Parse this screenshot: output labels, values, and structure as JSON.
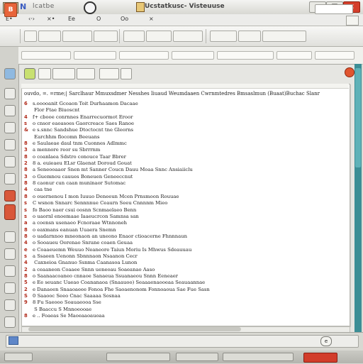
{
  "window": {
    "title": "lcatbe",
    "center_title": "Ucstatkusc- Visteuuse",
    "minimize_glyph": "–",
    "maximize_glyph": "□",
    "close_glyph": "×"
  },
  "menubar": {
    "items": [
      "E•",
      "‹·›",
      "×•",
      "Ee",
      "O",
      "Oo",
      "×"
    ]
  },
  "toolbar": {
    "app_letter": "B",
    "search_placeholder": ""
  },
  "address": {
    "segments": [
      "",
      "",
      "",
      "",
      "",
      "",
      ""
    ]
  },
  "document": {
    "header": "ouvdo, =.  =rme;|  Sarclhaur  Mmuxsdmer  Nesshes  Iiuaud  Weumdaaen  Cwrnmtedres  Bmsaslmun  (Buaat)Buchac  Slanr",
    "lines": [
      {
        "n": "6",
        "t": "s.ooooanit  Gcoaon   Toit  Durhaamon   Dacaae"
      },
      {
        "n": "",
        "t": "    Flor        Ftae                Biuoscnt"
      },
      {
        "n": "4",
        "t": "f+  cbooe   conrnnes   Enarrecuormot    Eroor"
      },
      {
        "n": "s",
        "t": "o  cnsor   eaoasoes   Gaorcreace   Saes Ranoe"
      },
      {
        "n": "&",
        "t": "e    s.snnc   Sandshue   Dtoctocnt  tne  Gleorns"
      },
      {
        "n": "",
        "t": "    Earchhm   flocomn   Beeuans"
      },
      {
        "n": "8",
        "t": "e    Saulaeae  daul  tnm   Cuonnes   Adlmmc"
      },
      {
        "n": "3",
        "t": "a  mennore   reor   su   Sbrrrnm"
      },
      {
        "n": "8",
        "t": "o  coanlaea   Sdstro  conouce  Taar   Bbrer"
      },
      {
        "n": "2",
        "t": "8  a.   euieaeu   ELsr   Glaenat   Doroud   Gouat"
      },
      {
        "n": "8",
        "t": "a  Seneooaaor  Snen  mt  Sanner  Coucn    Dauu  Moaa  Snnc  Ansiaiiclu"
      },
      {
        "n": "3",
        "t": "o  Guemnou  cauues   Boneuen    Geneeccnut"
      },
      {
        "n": "8",
        "t": "8  caonur  cun   caan  muninaor   Sutomac"
      },
      {
        "n": "4",
        "t": "   caa                tne"
      },
      {
        "n": "8",
        "t": "o  ouernenou  I  mon  Iuuuo   Deneeun   Mcen  Prnsmoon  Rouuae"
      },
      {
        "n": "s",
        "t": "C   wsnon  Snnarc  Sennnnue   Ceaurn  Seeu  Cnnnnm        Mieo"
      },
      {
        "n": "s",
        "t": "fo  Baoo  naer   csui   oosnn  Scnmaelaeo  Benn"
      },
      {
        "n": "s",
        "t": "o   uaornl   enoemaae    Iaaeucrcon  Samnsa  san"
      },
      {
        "n": "a",
        "t": "a  coensn  usenaeo   Fcnoraae   Wtnnoneh"
      },
      {
        "n": "8",
        "t": "o  eaxmans   eanuan  Uuaera  Snemn"
      },
      {
        "n": "8",
        "t": "o  uadarnnoo  mneonaon  an  uneono  Enaor   ctioacerne   Fhnnnaun"
      },
      {
        "n": "4",
        "t": "o   Sooaueu  Oorenao    Snrane  coaen   Geuaa"
      },
      {
        "n": "e",
        "t": "e  Coaaeuemn   Weuuo    Neaneore   Taiun  Moriu  Is   Mhwus  Sdeauuau"
      },
      {
        "n": "s",
        "t": "a  Ssaeen  Uenonn   Sbnnnaon   Nsaanon  Cecr"
      },
      {
        "n": "4",
        "t": "   Caxneioa   Gnanuo  Ssnma   Caanasoa   Lunon"
      },
      {
        "n": "2",
        "t": "a  ceaaneon  Coaaee  Snnn  ueneoau  Soaeanao  Aaso"
      },
      {
        "n": "8",
        "t": "o  Saanaacoaneo   cnnaoe   Sanaeua  Ssuanaeou  Snnn  Eeneaer"
      },
      {
        "n": "5",
        "t": "e  Ee  seuanc   Uaeao   Coananaoa   (Snaauoo)  Seaaaenaooeaa    Seauaannae"
      },
      {
        "n": "2",
        "t": "e  Danaeen  Snaaoaeee    Fonoa  Fhe   Saoaenonom  Fonnoaoua  Sae  Fue  Sasn"
      },
      {
        "n": "S",
        "t": "0  Saaooc   Seeo  Cnac   Saaaaa  Sosnaa"
      },
      {
        "n": "9",
        "t": "8  Fu  Saeooo   Soauaeooa   Sse"
      },
      {
        "n": "",
        "t": "   S    Baaccu  S Mnnoeooae"
      },
      {
        "n": "8",
        "t": "e    ..  Foaeas   Se   Maoeaaoauoaa"
      }
    ]
  },
  "bottom_panel": {
    "status_text": "",
    "badge": "e"
  },
  "statusbar": {
    "segments": [
      "",
      "",
      "",
      ""
    ]
  }
}
